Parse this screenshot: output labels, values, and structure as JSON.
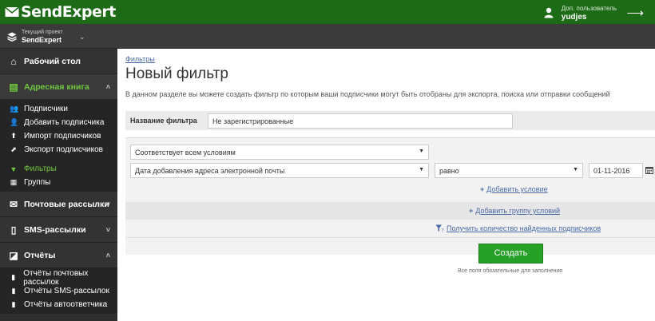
{
  "brand": {
    "name": "SendExpert",
    "color": "#1d6a17",
    "accent": "#6fc83f"
  },
  "user": {
    "caption": "Доп. пользователь",
    "name": "yudjes"
  },
  "project": {
    "caption": "Текущий проект",
    "name": "SendExpert"
  },
  "sidebar": {
    "dashboard": "Рабочий стол",
    "addressbook": {
      "label": "Адресная книга",
      "items": [
        {
          "label": "Подписчики",
          "icon": "users-icon"
        },
        {
          "label": "Добавить подписчика",
          "icon": "add-user-icon"
        },
        {
          "label": "Импорт подписчиков",
          "icon": "import-icon"
        },
        {
          "label": "Экспорт подписчиков",
          "icon": "export-icon"
        },
        {
          "label": "Фильтры",
          "icon": "filter-icon"
        },
        {
          "label": "Группы",
          "icon": "groups-icon"
        }
      ]
    },
    "mailings": "Почтовые рассылки",
    "sms": "SMS-рассылки",
    "reports": {
      "label": "Отчёты",
      "items": [
        {
          "label": "Отчёты почтовых рассылок"
        },
        {
          "label": "Отчёты SMS-рассылок"
        },
        {
          "label": "Отчёты автоответчика"
        }
      ]
    }
  },
  "main": {
    "breadcrumb": "Фильтры",
    "title": "Новый фильтр",
    "description": "В данном разделе вы можете создать фильтр по которым ваши подписчики могут быть отобраны для экспорта, поиска или отправки сообщений",
    "filter_name_label": "Название фильтра",
    "filter_name_value": "Не зарегистрированные",
    "match_mode": "Соответствует всем условиям",
    "condition": {
      "field": "Дата добавления адреса электронной почты",
      "operator": "равно",
      "value": "01-11-2016"
    },
    "add_condition": "Добавить условие",
    "add_group": "Добавить группу условий",
    "count_link": "Получить количество найденных подписчиков",
    "create_button": "Создать",
    "required_hint": "Все поля обязательные для заполнения"
  }
}
